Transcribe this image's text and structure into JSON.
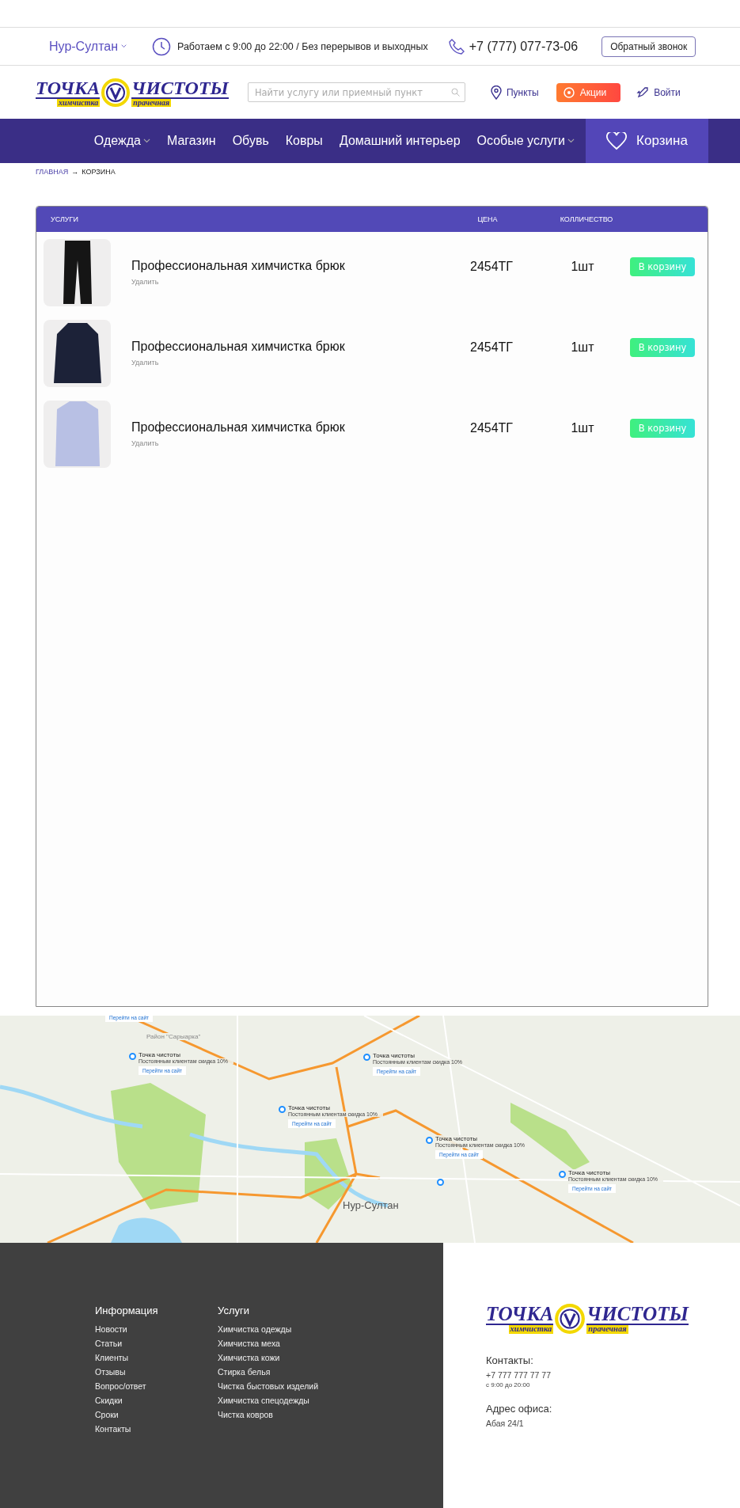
{
  "top_bar": {
    "city": "Нур-Султан",
    "hours": "Работаем с 9:00 до 22:00 / Без перерывов и выходных",
    "phone": "+7 (777) 077-73-06",
    "callback_button": "Обратный звонок"
  },
  "header": {
    "logo": {
      "main_left": "ТОЧКА",
      "main_right": "ЧИСТОТЫ",
      "sub_left": "химчистка",
      "sub_right": "прачечная"
    },
    "search": {
      "placeholder": "Найти услугу или приемный пункт"
    },
    "links": [
      {
        "kind": "points",
        "label": "Пункты"
      },
      {
        "kind": "promo",
        "label": "Акции"
      },
      {
        "kind": "login",
        "label": "Войти"
      }
    ]
  },
  "nav": {
    "items": [
      {
        "label": "Одежда",
        "dropdown": true
      },
      {
        "label": "Магазин",
        "dropdown": false
      },
      {
        "label": "Обувь",
        "dropdown": false
      },
      {
        "label": "Ковры",
        "dropdown": false
      },
      {
        "label": "Домашний интерьер",
        "dropdown": false
      },
      {
        "label": "Особые услуги",
        "dropdown": true
      }
    ],
    "cart": "Корзина"
  },
  "breadcrumb": {
    "items": [
      "ГЛАВНАЯ",
      "КОРЗИНА"
    ],
    "separator": "→"
  },
  "cart": {
    "columns": [
      "УСЛУГИ",
      "ЦЕНА",
      "КОЛЛИЧЕСТВО"
    ],
    "rows": [
      {
        "kind": "trousers",
        "title": "Профессиональная химчистка брюк",
        "remove": "Удалить",
        "price": "2454ТГ",
        "qty": "1шт",
        "button": "В корзину"
      },
      {
        "kind": "coat",
        "title": "Профессиональная химчистка брюк",
        "remove": "Удалить",
        "price": "2454ТГ",
        "qty": "1шт",
        "button": "В корзину"
      },
      {
        "kind": "shirt",
        "title": "Профессиональная химчистка брюк",
        "remove": "Удалить",
        "price": "2454ТГ",
        "qty": "1шт",
        "button": "В корзину"
      }
    ]
  },
  "map": {
    "top_link": "Перейти на сайт",
    "district": "Район \"Сарыарка\"",
    "city": "Нур-Султан",
    "pins": [
      {
        "kind": "card",
        "title": "Точка чистоты",
        "note": "Постоянным клиентам скидка 10%",
        "link": "Перейти на сайт"
      },
      {
        "kind": "card",
        "title": "Точка чистоты",
        "note": "Постоянным клиентам скидка 10%",
        "link": "Перейти на сайт"
      },
      {
        "kind": "card",
        "title": "Точка чистоты",
        "note": "Постоянным клиентам скидка 10%",
        "link": "Перейти на сайт"
      },
      {
        "kind": "card",
        "title": "Точка чистоты",
        "note": "Постоянным клиентам скидка 10%",
        "link": "Перейти на сайт"
      },
      {
        "kind": "card",
        "title": "Точка чистоты",
        "note": "Постоянным клиентам скидка 10%",
        "link": "Перейти на сайт"
      },
      {
        "kind": "dot"
      }
    ]
  },
  "footer": {
    "columns": [
      {
        "heading": "Информация",
        "items": [
          "Новости",
          "Статьи",
          "Клиенты",
          "Отзывы",
          "Вопрос/ответ",
          "Скидки",
          "Сроки",
          "Контакты"
        ]
      },
      {
        "heading": "Услуги",
        "items": [
          "Химчистка одежды",
          "Химчистка меха",
          "Химчистка кожи",
          "Стирка белья",
          "Чистка быстовых изделий",
          "Химчистка спецодежды",
          "Чистка ковров"
        ]
      }
    ],
    "logo": {
      "main_left": "ТОЧКА",
      "main_right": "ЧИСТОТЫ",
      "sub_left": "химчистка",
      "sub_right": "прачечная"
    },
    "contacts_heading": "Контакты:",
    "phone": "+7 777 777 77 77",
    "phone_hours": "с 9:00 до 20:00",
    "address_heading": "Адрес офиса:",
    "address": "Абая 24/1"
  }
}
